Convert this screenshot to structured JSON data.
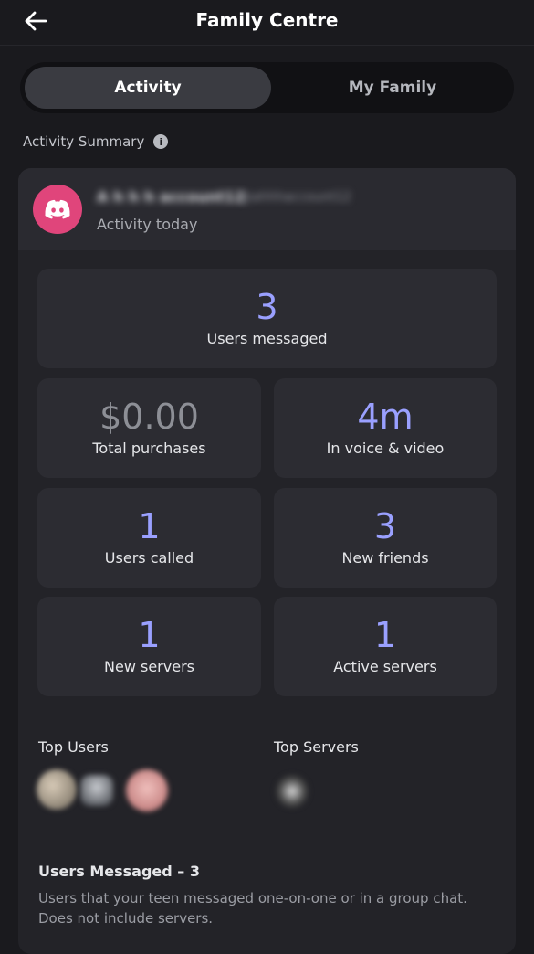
{
  "header": {
    "title": "Family Centre",
    "back_icon": "arrow-left-icon"
  },
  "tabs": [
    {
      "label": "Activity",
      "active": true
    },
    {
      "label": "My Family",
      "active": false
    }
  ],
  "summary": {
    "label": "Activity Summary",
    "info_icon": "i"
  },
  "profile": {
    "name": "A h h h account12",
    "tag": "@ahhhaccount12",
    "subtitle": "Activity today",
    "avatar_color": "#e0457b",
    "avatar_icon": "discord-logo-icon"
  },
  "stats": {
    "users_messaged": {
      "value": "3",
      "label": "Users messaged"
    },
    "total_purchases": {
      "value": "$0.00",
      "label": "Total purchases"
    },
    "voice_video": {
      "value": "4m",
      "label": "In voice & video"
    },
    "users_called": {
      "value": "1",
      "label": "Users called"
    },
    "new_friends": {
      "value": "3",
      "label": "New friends"
    },
    "new_servers": {
      "value": "1",
      "label": "New servers"
    },
    "active_servers": {
      "value": "1",
      "label": "Active servers"
    }
  },
  "top_users": {
    "heading": "Top Users"
  },
  "top_servers": {
    "heading": "Top Servers"
  },
  "users_messaged_section": {
    "heading": "Users Messaged – 3",
    "description": "Users that your teen messaged one-on-one or in a group chat. Does not include servers."
  },
  "colors": {
    "accent": "#9aa0ff",
    "background": "#1a1a1e",
    "card": "#232328",
    "tile": "#2c2c32"
  }
}
